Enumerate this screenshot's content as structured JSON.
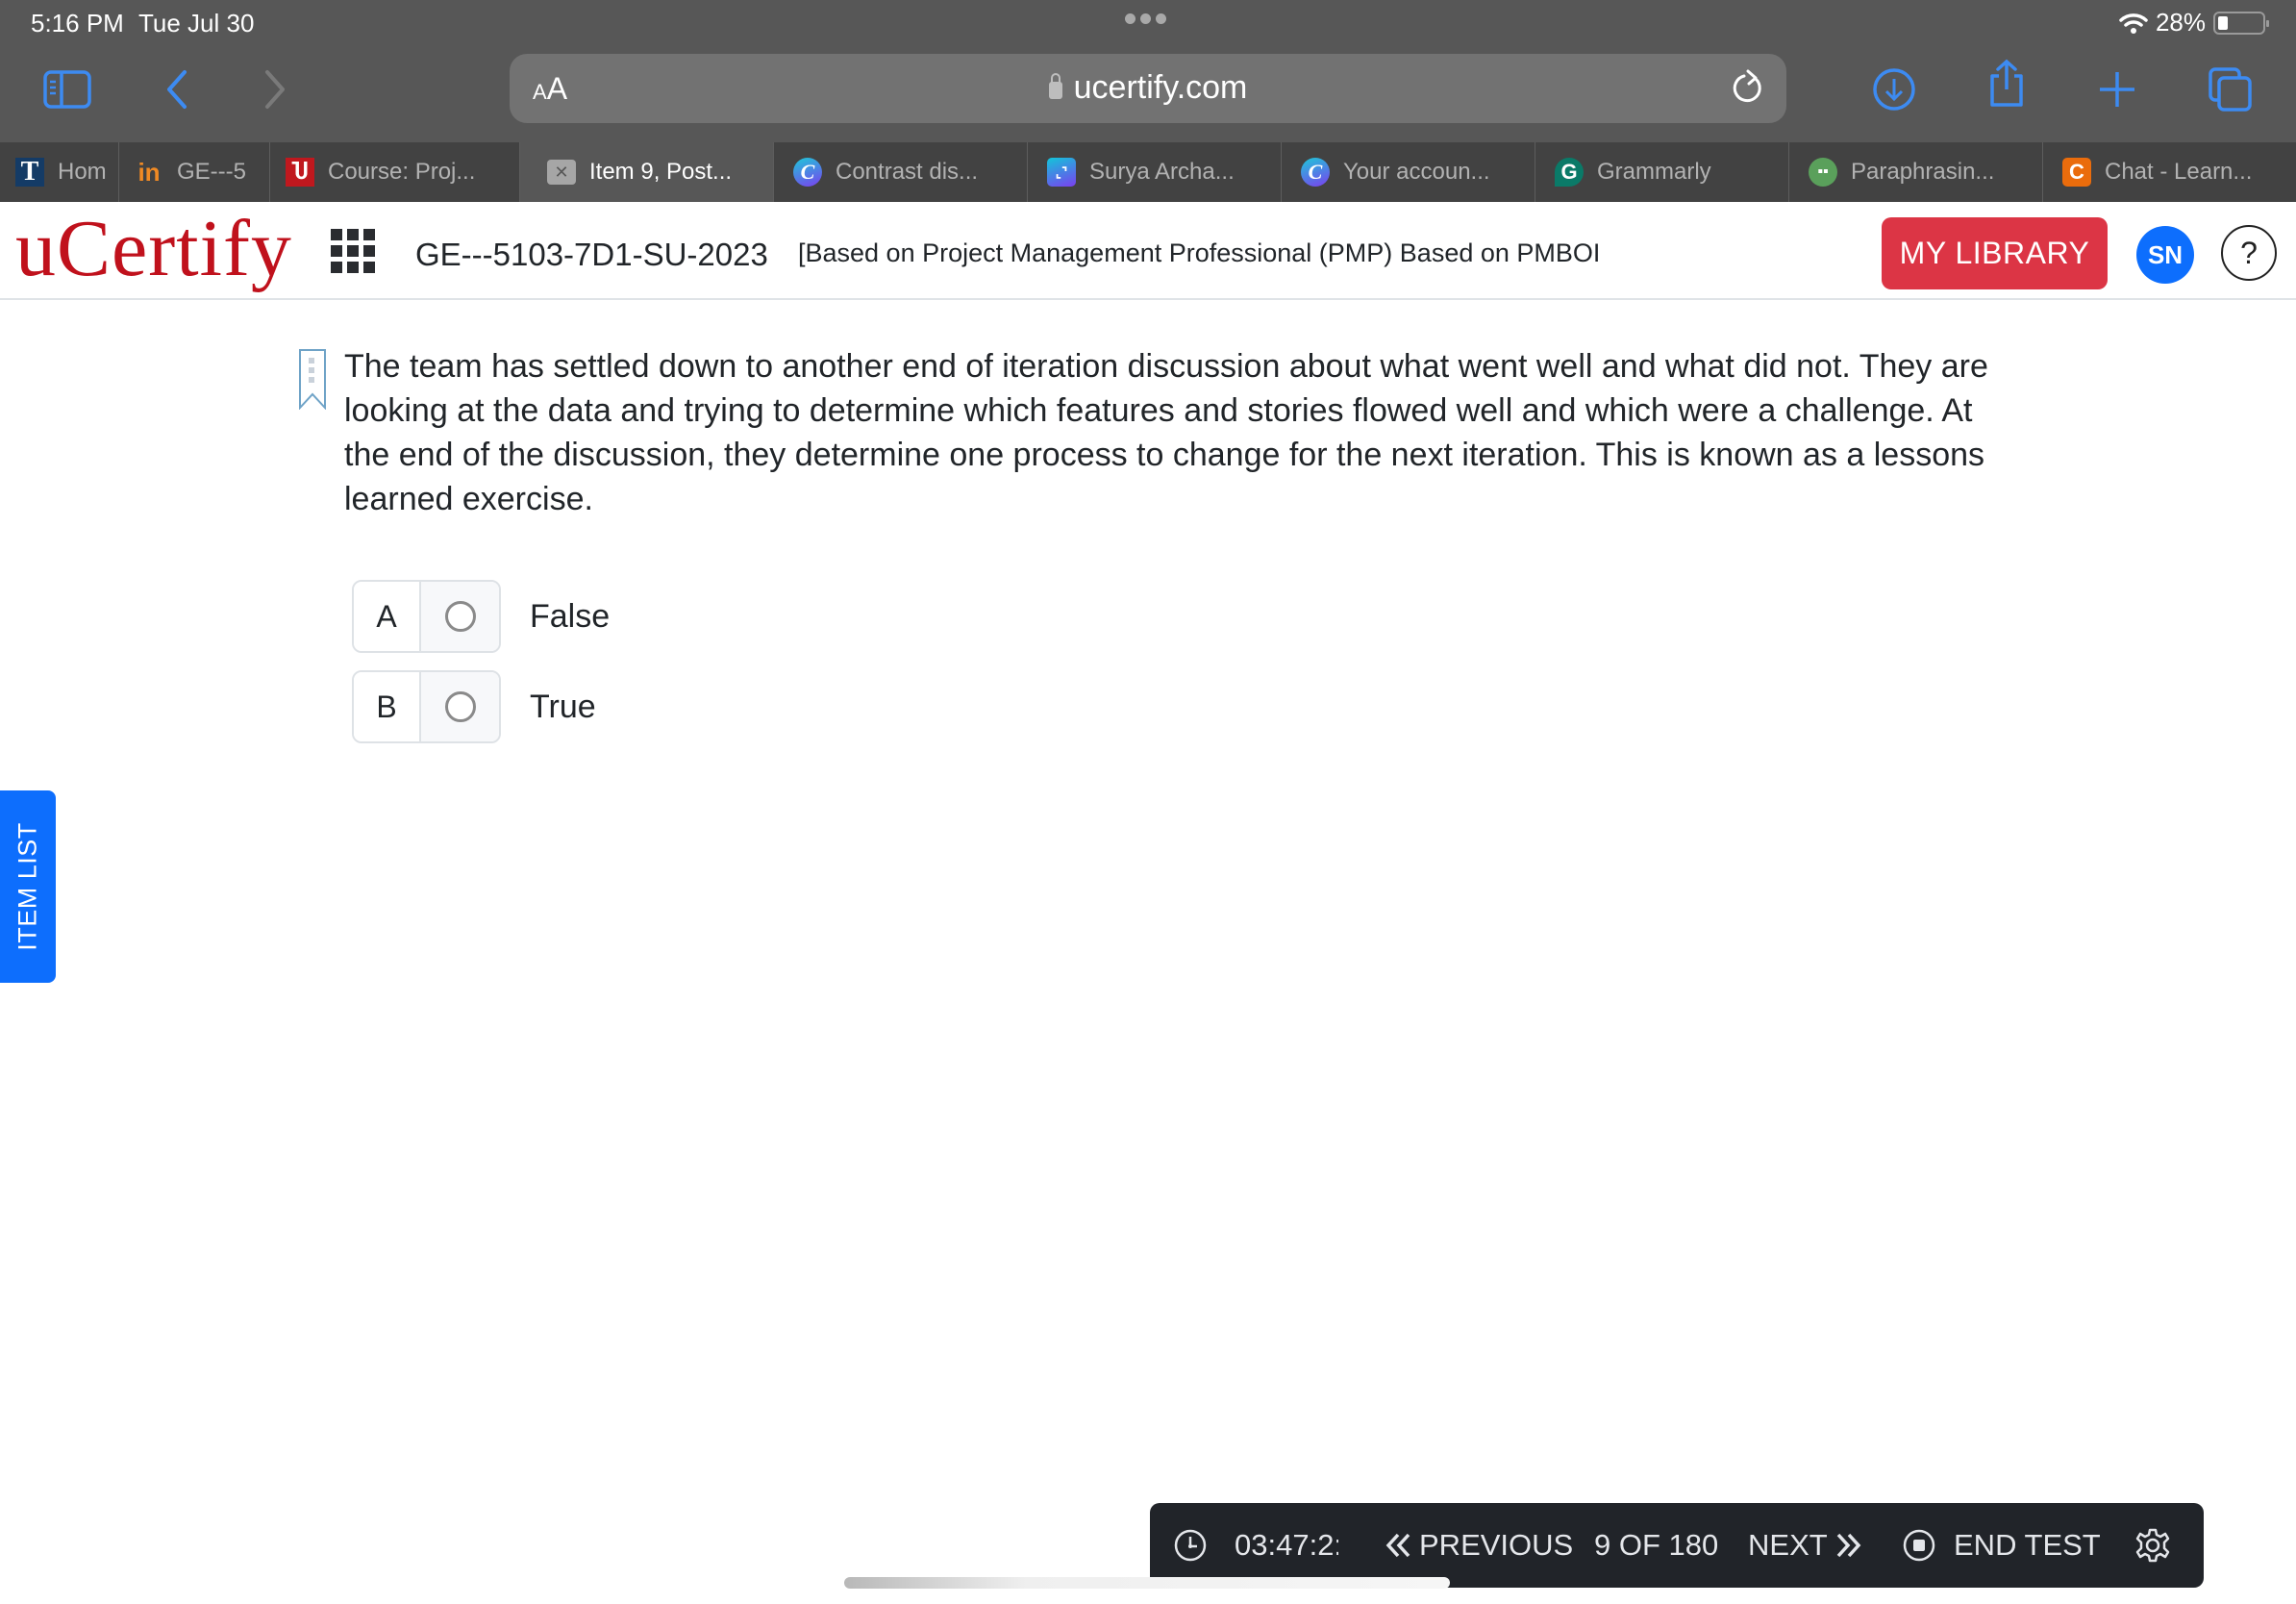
{
  "status_bar": {
    "time": "5:16 PM",
    "date": "Tue Jul 30",
    "battery": "28%",
    "battery_level": 0.28
  },
  "browser": {
    "text_size_label_small": "A",
    "text_size_label_large": "A",
    "url": "ucertify.com",
    "tabs": [
      {
        "label": "Hom",
        "icon": "t-favicon",
        "active": false
      },
      {
        "label": "GE---5",
        "icon": "in-favicon",
        "active": false
      },
      {
        "label": "Course: Proj...",
        "icon": "uc-favicon",
        "active": false
      },
      {
        "label": "Item 9, Post...",
        "icon": "close-tab-icon",
        "active": true
      },
      {
        "label": "Contrast dis...",
        "icon": "canva-favicon",
        "active": false
      },
      {
        "label": "Surya Archa...",
        "icon": "surya-favicon",
        "active": false
      },
      {
        "label": "Your accoun...",
        "icon": "canva-favicon",
        "active": false
      },
      {
        "label": "Grammarly",
        "icon": "grammarly-favicon",
        "active": false
      },
      {
        "label": "Paraphrasin...",
        "icon": "quillbot-favicon",
        "active": false
      },
      {
        "label": "Chat - Learn...",
        "icon": "chat-favicon",
        "active": false
      }
    ],
    "favicon_glyphs": {
      "t": "T",
      "in": "in",
      "uc": "Ⴎ",
      "x": "✕",
      "canva": "C",
      "surya": "⌞⌝",
      "g": "G",
      "para": "▪▪",
      "chat": "C"
    }
  },
  "header": {
    "logo": "uCertify",
    "course_code": "GE---5103-7D1-SU-2023",
    "course_title": "[Based on Project Management Professional (PMP) Based on PMBOI",
    "my_library_label": "MY LIBRARY",
    "avatar_initials": "SN",
    "help_label": "?",
    "brand_color": "#c0111c",
    "library_color": "#dc3545",
    "avatar_color": "#0d6efd"
  },
  "question": {
    "text": "The team has settled down to another end of iteration discussion about what went well and what did not. They are looking at the data and trying to determine which features and stories flowed well and which were a challenge. At the end of the discussion, they determine one process to change for the next iteration. This is known as a lessons learned exercise.",
    "options": [
      {
        "letter": "A",
        "label": "False",
        "selected": false
      },
      {
        "letter": "B",
        "label": "True",
        "selected": false
      }
    ]
  },
  "side_tab": {
    "label": "ITEM LIST"
  },
  "bottom_bar": {
    "timer": "03:47:2:",
    "previous_label": "PREVIOUS",
    "position": "9 OF 180",
    "next_label": "NEXT",
    "end_test_label": "END TEST"
  }
}
